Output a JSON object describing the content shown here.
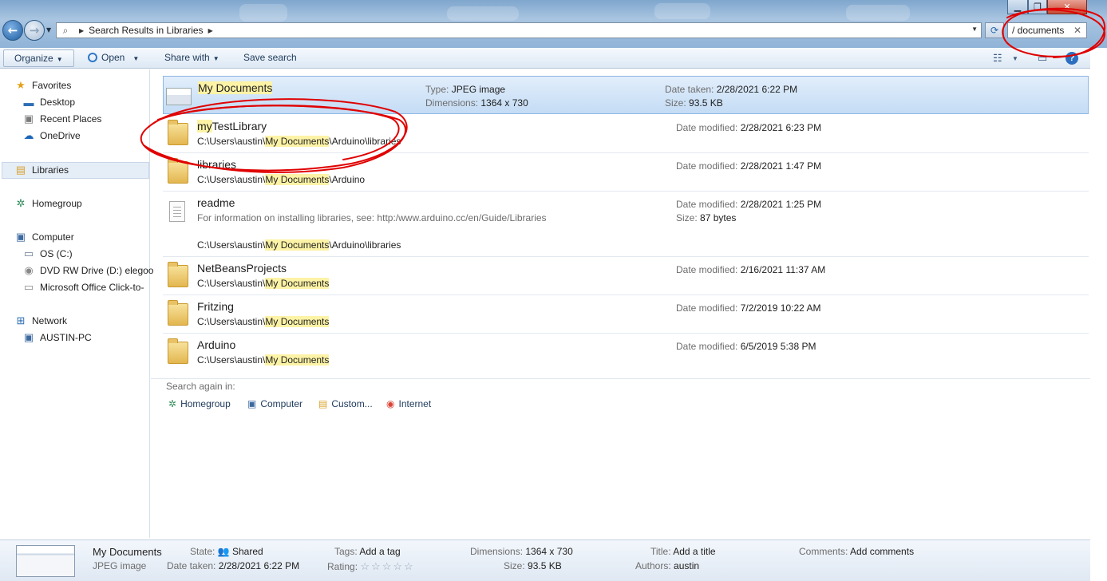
{
  "window": {
    "minimize_icon": "minimize-icon",
    "maximize_icon": "restore-icon",
    "close_icon": "close-icon"
  },
  "address": {
    "location": "Search Results in Libraries",
    "search_value": "/ documents"
  },
  "commands": {
    "organize": "Organize",
    "open": "Open",
    "share_with": "Share with",
    "save_search": "Save search"
  },
  "nav": {
    "favorites": "Favorites",
    "desktop": "Desktop",
    "recent_places": "Recent Places",
    "onedrive": "OneDrive",
    "libraries": "Libraries",
    "homegroup": "Homegroup",
    "computer": "Computer",
    "os_c": "OS (C:)",
    "dvd": "DVD RW Drive (D:) elegoo",
    "office": "Microsoft Office Click-to-",
    "network": "Network",
    "austin_pc": "AUSTIN-PC"
  },
  "results": [
    {
      "name": "My Documents",
      "type_label": "Type:",
      "type_value": "JPEG image",
      "dim_label": "Dimensions:",
      "dim_value": "1364 x 730",
      "date_label": "Date taken:",
      "date_value": "2/28/2021 6:22 PM",
      "size_label": "Size:",
      "size_value": "93.5 KB"
    },
    {
      "name_hl": "my",
      "name_rest": "TestLibrary",
      "path_pre": "C:\\Users\\austin\\",
      "path_hl": "My Documents",
      "path_post": "\\Arduino\\libraries",
      "date_label": "Date modified:",
      "date_value": "2/28/2021 6:23 PM"
    },
    {
      "name": "libraries",
      "path_pre": "C:\\Users\\austin\\",
      "path_hl": "My Documents",
      "path_post": "\\Arduino",
      "date_label": "Date modified:",
      "date_value": "2/28/2021 1:47 PM"
    },
    {
      "name": "readme",
      "desc": "For information on installing libraries, see: http:/www.arduino.cc/en/Guide/Libraries",
      "path_pre": "C:\\Users\\austin\\",
      "path_hl": "My Documents",
      "path_post": "\\Arduino\\libraries",
      "date_label": "Date modified:",
      "date_value": "2/28/2021 1:25 PM",
      "size_label": "Size:",
      "size_value": "87 bytes"
    },
    {
      "name": "NetBeansProjects",
      "path_pre": "C:\\Users\\austin\\",
      "path_hl": "My Documents",
      "date_label": "Date modified:",
      "date_value": "2/16/2021 11:37 AM"
    },
    {
      "name": "Fritzing",
      "path_pre": "C:\\Users\\austin\\",
      "path_hl": "My Documents",
      "date_label": "Date modified:",
      "date_value": "7/2/2019 10:22 AM"
    },
    {
      "name": "Arduino",
      "path_pre": "C:\\Users\\austin\\",
      "path_hl": "My Documents",
      "date_label": "Date modified:",
      "date_value": "6/5/2019 5:38 PM"
    }
  ],
  "search_again": {
    "label": "Search again in:",
    "homegroup": "Homegroup",
    "computer": "Computer",
    "custom": "Custom...",
    "internet": "Internet"
  },
  "details": {
    "name": "My Documents",
    "type": "JPEG image",
    "state_label": "State:",
    "state_value": "Shared",
    "date_label": "Date taken:",
    "date_value": "2/28/2021 6:22 PM",
    "tags_label": "Tags:",
    "tags_value": "Add a tag",
    "rating_label": "Rating:",
    "rating_stars": 0,
    "dim_label": "Dimensions:",
    "dim_value": "1364 x 730",
    "size_label": "Size:",
    "size_value": "93.5 KB",
    "title_label": "Title:",
    "title_value": "Add a title",
    "authors_label": "Authors:",
    "authors_value": "austin",
    "comments_label": "Comments:",
    "comments_value": "Add comments"
  },
  "colors": {
    "highlight": "#fdf3a6",
    "selection": "#c4dcf5",
    "annotation": "#e00000"
  }
}
